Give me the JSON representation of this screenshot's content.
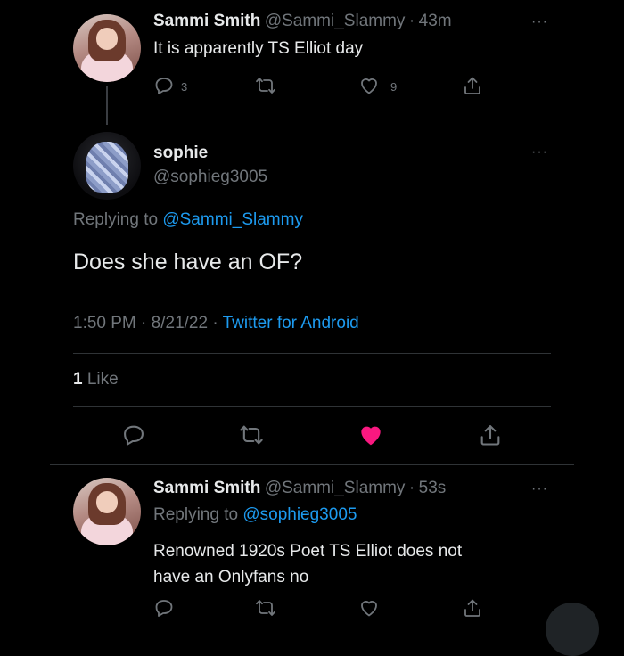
{
  "tweet1": {
    "name": "Sammi Smith",
    "handle": "@Sammi_Slammy",
    "sep": "·",
    "time": "43m",
    "text": "It is apparently TS Elliot day",
    "reply_count": "3",
    "like_count": "9"
  },
  "main": {
    "name": "sophie",
    "handle": "@sophieg3005",
    "replying_prefix": "Replying to",
    "replying_handle": "@Sammi_Slammy",
    "text": "Does she have an OF?",
    "time": "1:50 PM",
    "sep1": "·",
    "date": "8/21/22",
    "sep2": "·",
    "source": "Twitter for Android",
    "likes_count": "1",
    "likes_label": "Like",
    "liked": true,
    "like_color": "#f91880"
  },
  "reply": {
    "name": "Sammi Smith",
    "handle": "@Sammi_Slammy",
    "sep": "·",
    "time": "53s",
    "replying_prefix": "Replying to",
    "replying_handle": "@sophieg3005",
    "line1": "Renowned 1920s Poet TS Elliot does not",
    "line2": "have an Onlyfans no"
  },
  "more_glyph": "···",
  "icons": [
    "reply-icon",
    "retweet-icon",
    "like-icon",
    "share-icon",
    "more-icon"
  ],
  "colors": {
    "background": "#000000",
    "link": "#1d9bf0",
    "muted": "#71767b",
    "like": "#f91880"
  }
}
